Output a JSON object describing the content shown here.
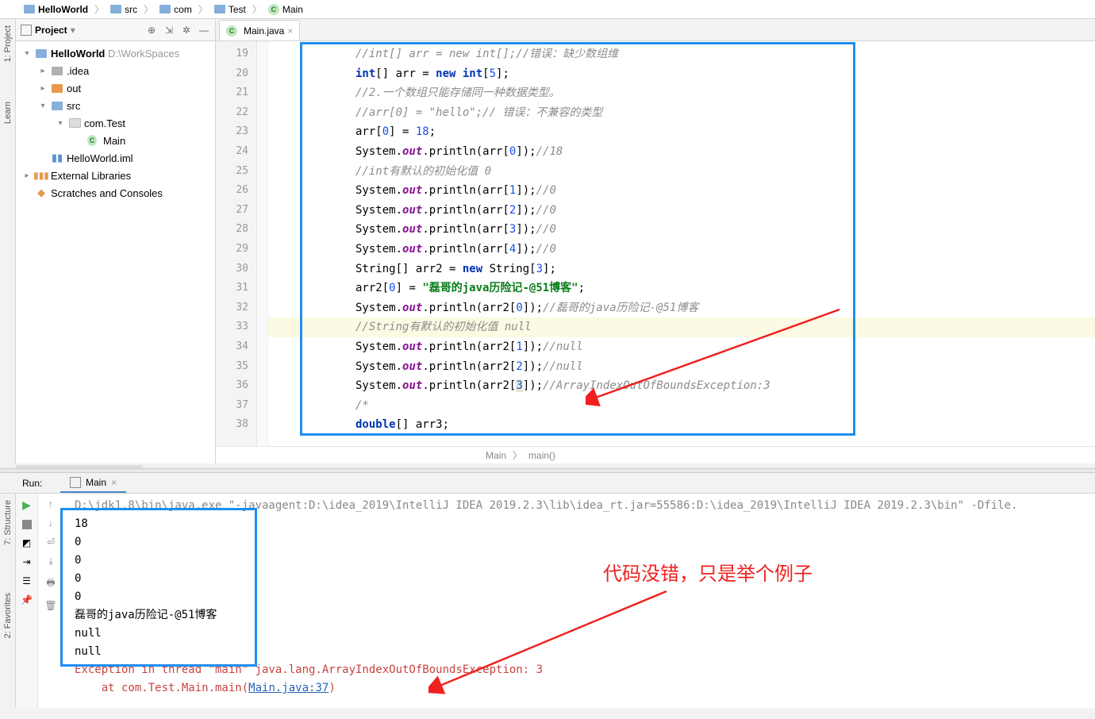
{
  "breadcrumbs": {
    "root": "HelloWorld",
    "src": "src",
    "com": "com",
    "test": "Test",
    "main": "Main"
  },
  "panel": {
    "title": "Project"
  },
  "sidebar": {
    "project": "1: Project",
    "learn": "Learn",
    "structure": "7: Structure",
    "favorites": "2: Favorites"
  },
  "tree": {
    "root": "HelloWorld",
    "rootPath": "D:\\WorkSpaces",
    "idea": ".idea",
    "out": "out",
    "src": "src",
    "comTest": "com.Test",
    "main": "Main",
    "iml": "HelloWorld.iml",
    "libs": "External Libraries",
    "scratches": "Scratches and Consoles"
  },
  "tab": {
    "name": "Main.java"
  },
  "gutterStart": 19,
  "code": {
    "l19": "//int[] arr = new int[];//错误：缺少数组维",
    "l21": "//2.一个数组只能存储同一种数据类型。",
    "l22": "//arr[0] = \"hello\";// 错误：不兼容的类型",
    "l24a": "System.",
    "l24b": "out",
    "l24c": ".println(arr[",
    "l24d": "0",
    "l24e": "]);",
    "l24f": "//18",
    "l25": "//int有默认的初始化值 0",
    "l31b": "0",
    "l31c": "] = ",
    "l31d": "\"磊哥的java历险记-@51博客\"",
    "l32f": "//磊哥的java历险记-@51博客",
    "l33": "//String有默认的初始化值 null",
    "l34f": "//null",
    "l36f": "//ArrayIndexOutOfBoundsException:3",
    "l37": "/*",
    "l38a": "double",
    "l38b": "[] arr3;"
  },
  "bc": {
    "class": "Main",
    "method": "main()"
  },
  "run": {
    "title": "Run:",
    "tab": "Main",
    "cmd": "D:\\jdk1.8\\bin\\java.exe \"-javaagent:D:\\idea_2019\\IntelliJ IDEA 2019.2.3\\lib\\idea_rt.jar=55586:D:\\idea_2019\\IntelliJ IDEA 2019.2.3\\bin\" -Dfile.",
    "out": [
      "18",
      "0",
      "0",
      "0",
      "0",
      "磊哥的java历险记-@51博客",
      "null",
      "null"
    ],
    "err1": "Exception in thread \"main\" java.lang.ArrayIndexOutOfBoundsException: 3",
    "err2a": "    at com.Test.Main.main(",
    "err2link": "Main.java:37",
    "err2b": ")"
  },
  "annotation": "代码没错，只是举个例子"
}
